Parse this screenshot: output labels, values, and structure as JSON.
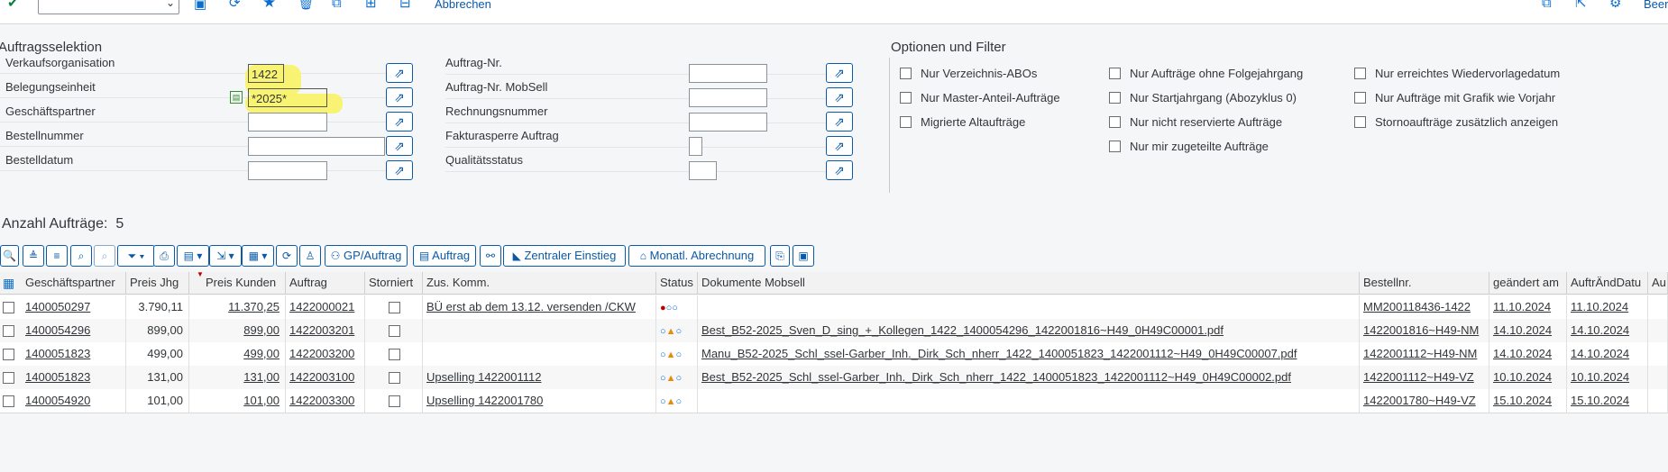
{
  "toolbar": {
    "abbrechen_label": "Abbrechen",
    "beenden_label": "Beer"
  },
  "selection": {
    "title": "Auftragsselektion",
    "left_rows": [
      {
        "label": "Verkaufsorganisation",
        "value": "1422"
      },
      {
        "label": "Belegungseinheit",
        "value": "*2025*"
      },
      {
        "label": "Geschäftspartner",
        "value": ""
      },
      {
        "label": "Bestellnummer",
        "value": ""
      },
      {
        "label": "Bestelldatum",
        "value": ""
      }
    ],
    "mid_rows": [
      {
        "label": "Auftrag-Nr.",
        "value": ""
      },
      {
        "label": "Auftrag-Nr. MobSell",
        "value": ""
      },
      {
        "label": "Rechnungsnummer",
        "value": ""
      },
      {
        "label": "Fakturasperre Auftrag",
        "value": ""
      },
      {
        "label": "Qualitätsstatus",
        "value": ""
      }
    ]
  },
  "options": {
    "title": "Optionen und Filter",
    "col1": [
      "Nur Verzeichnis-ABOs",
      "Nur Master-Anteil-Aufträge",
      "Migrierte Altaufträge"
    ],
    "col2": [
      "Nur Aufträge ohne Folgejahrgang",
      "Nur Startjahrgang (Abozyklus 0)",
      "Nur nicht reservierte Aufträge",
      "Nur mir zugeteilte Aufträge"
    ],
    "col3": [
      "Nur erreichtes Wiedervorlagedatum",
      "Nur Aufträge mit Grafik wie Vorjahr",
      "Stornoaufträge zusätzlich anzeigen"
    ]
  },
  "count": {
    "label": "Anzahl Aufträge:",
    "value": "5"
  },
  "grid_toolbar": {
    "gp_auftrag": "GP/Auftrag",
    "auftrag": "Auftrag",
    "zentraler_einstieg": "Zentraler Einstieg",
    "monatl_abrechnung": "Monatl. Abrechnung"
  },
  "table": {
    "headers": [
      "Geschäftspartner",
      "Preis Jhg",
      "Preis Kunden",
      "Auftrag",
      "Storniert",
      "Zus. Komm.",
      "Status",
      "Dokumente Mobsell",
      "Bestellnr.",
      "geändert am",
      "AuftrÄndDatu",
      "Au"
    ],
    "rows": [
      {
        "gp": "1400050297",
        "preis_jhg": "3.790,11",
        "preis_kunden": "11.370,25",
        "auftrag": "1422000021",
        "zus": "BÜ erst ab dem 13.12. versenden /CKW",
        "status": "red",
        "doc": "",
        "bestellnr": "MM200118436-1422",
        "geaendert": "11.10.2024",
        "aend": "11.10.2024"
      },
      {
        "gp": "1400054296",
        "preis_jhg": "899,00",
        "preis_kunden": "899,00",
        "auftrag": "1422003201",
        "zus": "",
        "status": "yellow",
        "doc": "Best_B52-2025_Sven_D_sing_+_Kollegen_1422_1400054296_1422001816~H49_0H49C00001.pdf",
        "bestellnr": "1422001816~H49-NM",
        "geaendert": "14.10.2024",
        "aend": "14.10.2024"
      },
      {
        "gp": "1400051823",
        "preis_jhg": "499,00",
        "preis_kunden": "499,00",
        "auftrag": "1422003200",
        "zus": "",
        "status": "yellow",
        "doc": "Manu_B52-2025_Schl_ssel-Garber_Inh._Dirk_Sch_nherr_1422_1400051823_1422001112~H49_0H49C00007.pdf",
        "bestellnr": "1422001112~H49-NM",
        "geaendert": "14.10.2024",
        "aend": "14.10.2024"
      },
      {
        "gp": "1400051823",
        "preis_jhg": "131,00",
        "preis_kunden": "131,00",
        "auftrag": "1422003100",
        "zus": "Upselling 1422001112",
        "status": "yellow",
        "doc": "Best_B52-2025_Schl_ssel-Garber_Inh._Dirk_Sch_nherr_1422_1400051823_1422001112~H49_0H49C00002.pdf",
        "bestellnr": "1422001112~H49-VZ",
        "geaendert": "10.10.2024",
        "aend": "10.10.2024"
      },
      {
        "gp": "1400054920",
        "preis_jhg": "101,00",
        "preis_kunden": "101,00",
        "auftrag": "1422003300",
        "zus": "Upselling 1422001780",
        "status": "yellow",
        "doc": "",
        "bestellnr": "1422001780~H49-VZ",
        "geaendert": "15.10.2024",
        "aend": "15.10.2024"
      }
    ]
  },
  "colors": {
    "accent": "#0a6ed1",
    "highlight": "#f8f26a",
    "status_red": "#bb0000",
    "status_yellow": "#e78c07",
    "status_grey": "#0a6ed1"
  }
}
